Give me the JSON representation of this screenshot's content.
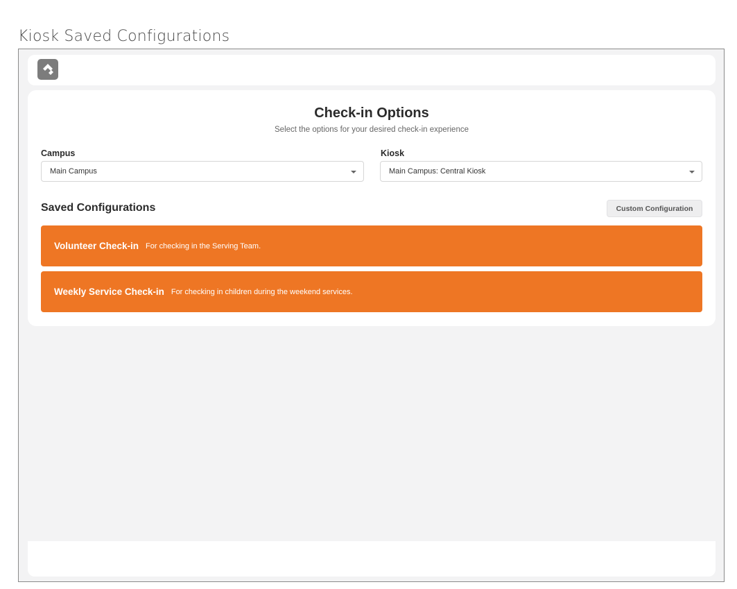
{
  "page": {
    "title": "Kiosk Saved Configurations"
  },
  "header": {
    "logo_icon": "rock-logo-icon"
  },
  "options": {
    "title": "Check-in Options",
    "subtitle": "Select the options for your desired check-in experience",
    "campus": {
      "label": "Campus",
      "value": "Main Campus"
    },
    "kiosk": {
      "label": "Kiosk",
      "value": "Main Campus: Central Kiosk"
    }
  },
  "saved": {
    "title": "Saved Configurations",
    "custom_button_label": "Custom Configuration",
    "accent_color": "#ee7624",
    "items": [
      {
        "name": "Volunteer Check-in",
        "description": "For checking in the Serving Team."
      },
      {
        "name": "Weekly Service Check-in",
        "description": "For checking in children during the weekend services."
      }
    ]
  }
}
